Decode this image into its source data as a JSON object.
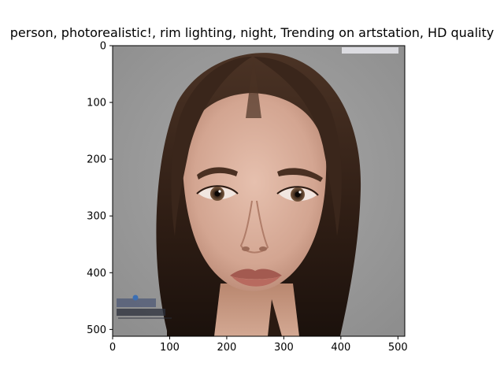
{
  "figure": {
    "title": "person,  photorealistic!, rim lighting, night, Trending on artstation, HD quality",
    "image": {
      "subject": "photorealistic portrait of a young woman with brown hair parted in the middle",
      "background_color": "#9e9e9e",
      "watermark_top_right": "",
      "watermark_bottom_left": ""
    },
    "axes": {
      "xlim": [
        0,
        512
      ],
      "ylim": [
        512,
        0
      ],
      "xticks": [
        {
          "value": 0,
          "label": "0"
        },
        {
          "value": 100,
          "label": "100"
        },
        {
          "value": 200,
          "label": "200"
        },
        {
          "value": 300,
          "label": "300"
        },
        {
          "value": 400,
          "label": "400"
        },
        {
          "value": 500,
          "label": "500"
        }
      ],
      "yticks": [
        {
          "value": 0,
          "label": "0"
        },
        {
          "value": 100,
          "label": "100"
        },
        {
          "value": 200,
          "label": "200"
        },
        {
          "value": 300,
          "label": "300"
        },
        {
          "value": 400,
          "label": "400"
        },
        {
          "value": 500,
          "label": "500"
        }
      ]
    }
  }
}
